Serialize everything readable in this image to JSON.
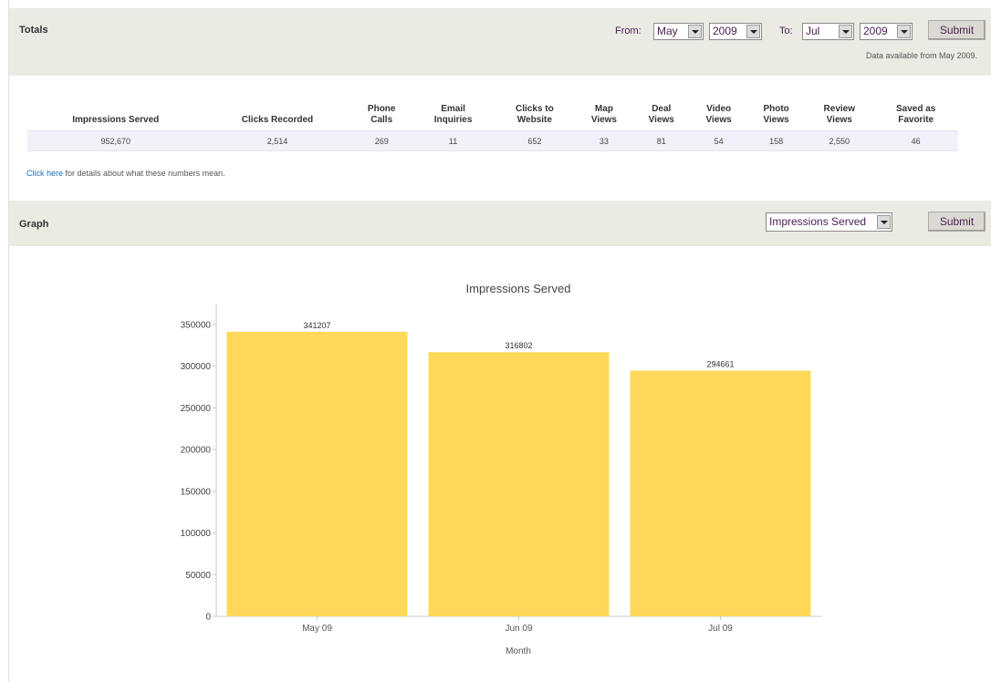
{
  "totals_header": {
    "title": "Totals",
    "from_label": "From:",
    "from_month": "May",
    "from_year": "2009",
    "to_label": "To:",
    "to_month": "Jul",
    "to_year": "2009",
    "submit_label": "Submit",
    "availability_note": "Data available from May 2009."
  },
  "totals_table": {
    "columns": [
      [
        "Impressions Served"
      ],
      [
        "Clicks Recorded"
      ],
      [
        "Phone",
        "Calls"
      ],
      [
        "Email",
        "Inquiries"
      ],
      [
        "Clicks to",
        "Website"
      ],
      [
        "Map",
        "Views"
      ],
      [
        "Deal",
        "Views"
      ],
      [
        "Video",
        "Views"
      ],
      [
        "Photo",
        "Views"
      ],
      [
        "Review",
        "Views"
      ],
      [
        "Saved as",
        "Favorite"
      ]
    ],
    "values": [
      "952,670",
      "2,514",
      "269",
      "11",
      "652",
      "33",
      "81",
      "54",
      "158",
      "2,550",
      "46"
    ]
  },
  "details_link": {
    "link_text": "Click here",
    "rest_text": " for details about what these numbers mean."
  },
  "graph_header": {
    "title": "Graph",
    "metric_selected": "Impressions Served",
    "submit_label": "Submit"
  },
  "chart_data": {
    "type": "bar",
    "title": "Impressions Served",
    "xlabel": "Month",
    "ylabel": "",
    "categories": [
      "May 09",
      "Jun 09",
      "Jul 09"
    ],
    "values": [
      341207,
      316802,
      294661
    ],
    "data_labels": [
      "341207",
      "316802",
      "294661"
    ],
    "yticks": [
      0,
      50000,
      100000,
      150000,
      200000,
      250000,
      300000,
      350000
    ],
    "ylim": [
      0,
      375000
    ],
    "grid": false,
    "bar_color": "#fed959"
  },
  "colors": {
    "header_bg": "#ebebe4",
    "link": "#1b6fbf",
    "control_text": "#4a1e55",
    "row_bg": "#f2f1f9"
  }
}
